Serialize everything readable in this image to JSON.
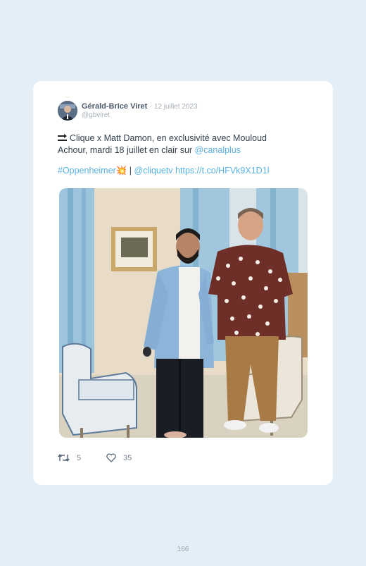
{
  "tweet": {
    "author_name": "Gérald-Brice Viret",
    "separator": "·",
    "date": "12 juillet 2023",
    "handle": "@gbviret",
    "line1": "Clique x Matt Damon, en exclusivité avec Mouloud",
    "line2_prefix": "Achour, mardi 18 juillet en clair sur ",
    "mention_canal": "@canalplus",
    "hashtag": "#Oppenheimer",
    "emoji": "💥",
    "pipe": " | ",
    "mention_clique": "@cliquetv",
    "link": "https://t.co/HFVk9X1D1l",
    "retweets": "5",
    "likes": "35",
    "icons": [
      "soon-arrow-icon",
      "retweet-icon",
      "heart-icon"
    ]
  },
  "page_number": "166",
  "colors": {
    "link": "#58b1e3",
    "background": "#e4eef7",
    "card": "#ffffff"
  }
}
